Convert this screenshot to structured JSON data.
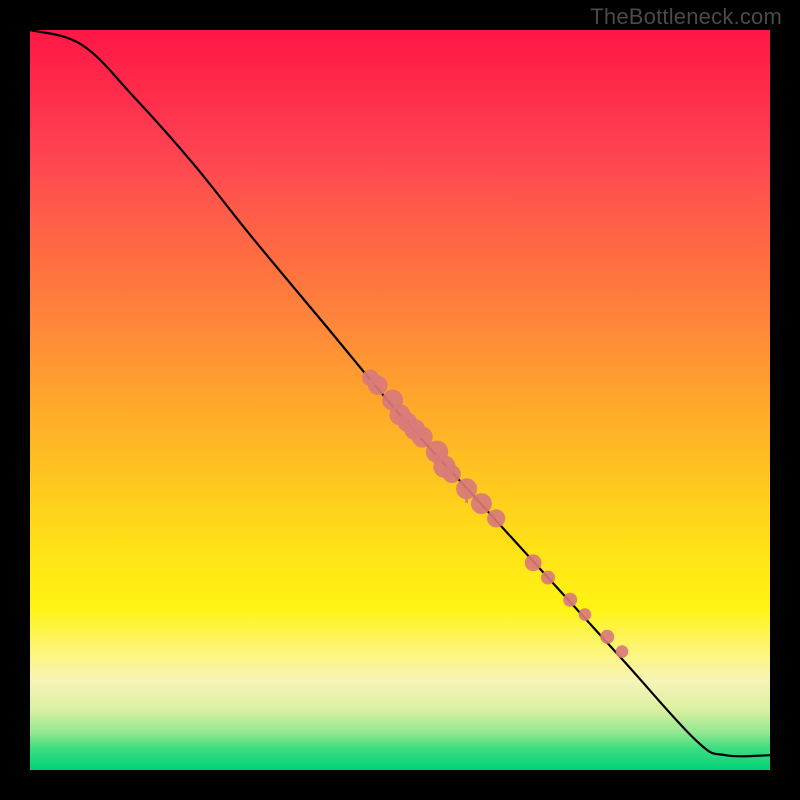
{
  "watermark": "TheBottleneck.com",
  "chart_data": {
    "type": "line",
    "title": "",
    "xlabel": "",
    "ylabel": "",
    "xlim": [
      0,
      100
    ],
    "ylim": [
      0,
      100
    ],
    "axes_visible": false,
    "background": "red-yellow-green vertical gradient",
    "line": {
      "description": "monotonically decreasing curve from top-left to bottom-right",
      "points": [
        {
          "x": 0,
          "y": 100
        },
        {
          "x": 7,
          "y": 98
        },
        {
          "x": 14,
          "y": 91
        },
        {
          "x": 22,
          "y": 82
        },
        {
          "x": 30,
          "y": 72
        },
        {
          "x": 40,
          "y": 60
        },
        {
          "x": 50,
          "y": 48
        },
        {
          "x": 60,
          "y": 37
        },
        {
          "x": 70,
          "y": 26
        },
        {
          "x": 80,
          "y": 15
        },
        {
          "x": 90,
          "y": 4
        },
        {
          "x": 94,
          "y": 2
        },
        {
          "x": 100,
          "y": 2
        }
      ]
    },
    "markers": {
      "description": "salmon colored dots placed along the middle and lower portion of the curve",
      "points": [
        {
          "x": 46,
          "y": 53,
          "r": 1.2
        },
        {
          "x": 47,
          "y": 52,
          "r": 1.4
        },
        {
          "x": 49,
          "y": 50,
          "r": 1.5
        },
        {
          "x": 50,
          "y": 48,
          "r": 1.5
        },
        {
          "x": 51,
          "y": 47,
          "r": 1.4
        },
        {
          "x": 52,
          "y": 46,
          "r": 1.5
        },
        {
          "x": 53,
          "y": 45,
          "r": 1.5
        },
        {
          "x": 55,
          "y": 43,
          "r": 1.6
        },
        {
          "x": 56,
          "y": 41,
          "r": 1.6
        },
        {
          "x": 57,
          "y": 40,
          "r": 1.3
        },
        {
          "x": 59,
          "y": 38,
          "r": 1.5
        },
        {
          "x": 61,
          "y": 36,
          "r": 1.5
        },
        {
          "x": 63,
          "y": 34,
          "r": 1.3
        },
        {
          "x": 68,
          "y": 28,
          "r": 1.2
        },
        {
          "x": 70,
          "y": 26,
          "r": 1.0
        },
        {
          "x": 73,
          "y": 23,
          "r": 1.0
        },
        {
          "x": 75,
          "y": 21,
          "r": 0.9
        },
        {
          "x": 78,
          "y": 18,
          "r": 1.0
        },
        {
          "x": 80,
          "y": 16,
          "r": 0.9
        }
      ]
    }
  }
}
